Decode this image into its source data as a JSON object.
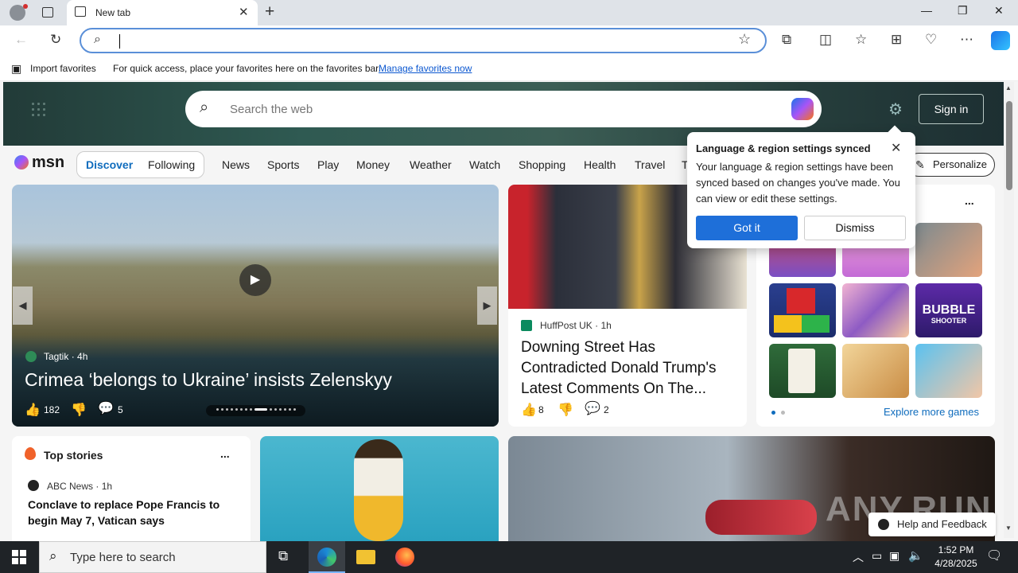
{
  "browser": {
    "tab_title": "New tab",
    "new_tab_symbol": "+",
    "close_tab_symbol": "✕",
    "minimize": "—",
    "restore": "❐",
    "close": "✕",
    "address_value": ""
  },
  "favorites_bar": {
    "import_label": "Import favorites",
    "hint": "For quick access, place your favorites here on the favorites bar.",
    "manage_link": "Manage favorites now"
  },
  "msn": {
    "search_placeholder": "Search the web",
    "sign_in": "Sign in",
    "logo_text": "msn",
    "tabs": [
      "Discover",
      "Following"
    ],
    "nav": [
      "News",
      "Sports",
      "Play",
      "Money",
      "Weather",
      "Watch",
      "Shopping",
      "Health",
      "Travel",
      "T"
    ],
    "personalize": "Personalize"
  },
  "lead_story": {
    "source": "Tagtik",
    "age": "4h",
    "headline": "Crimea ‘belongs to Ukraine’ insists Zelenskyy",
    "likes": "182",
    "comments": "5"
  },
  "second_story": {
    "source": "HuffPost UK",
    "age": "1h",
    "headline": "Downing Street Has Contradicted Donald Trump's Latest Comments On The...",
    "likes": "8",
    "comments": "2"
  },
  "popup": {
    "title": "Language & region settings synced",
    "body": "Your language & region settings have been synced based on changes you've made. You can view or edit these settings.",
    "got_it": "Got it",
    "dismiss": "Dismiss"
  },
  "games": {
    "more_menu": "...",
    "explore": "Explore more games",
    "bubble_line1": "BUBBLE",
    "bubble_line2": "SHOOTER"
  },
  "top_stories": {
    "title": "Top stories",
    "more_menu": "...",
    "source": "ABC News",
    "age": "1h",
    "headline": "Conclave to replace Pope Francis to begin May 7, Vatican says"
  },
  "overlay": {
    "watermark": "ANY.RUN",
    "help_feedback": "Help and Feedback"
  },
  "taskbar": {
    "search_placeholder": "Type here to search",
    "time": "1:52 PM",
    "date": "4/28/2025"
  }
}
